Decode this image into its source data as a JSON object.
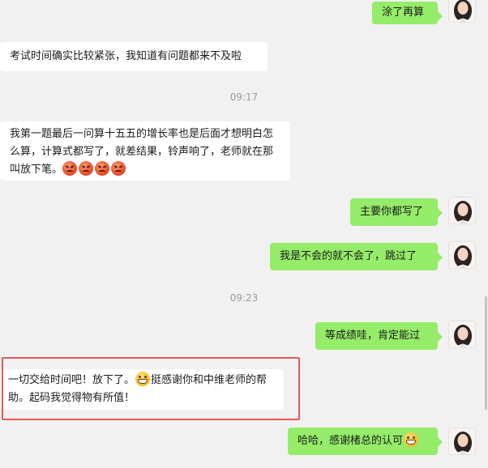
{
  "messages": [
    {
      "id": "m1",
      "type": "out",
      "text": "涂了再算"
    },
    {
      "id": "m2",
      "type": "in",
      "text": "考试时间确实比较紧张，我知道有问题都来不及啦"
    },
    {
      "id": "t1",
      "type": "time",
      "text": "09:17"
    },
    {
      "id": "m3",
      "type": "in",
      "text": "我第一题最后一问算十五五的增长率也是后面才想明白怎么算，计算式都写了，就差结果，铃声响了，老师就在那叫放下笔。",
      "emoji": "angry-face",
      "emoji_count": 4
    },
    {
      "id": "m4",
      "type": "out",
      "text": "主要你都写了"
    },
    {
      "id": "m5",
      "type": "out",
      "text": "我是不会的就不会了，跳过了"
    },
    {
      "id": "t2",
      "type": "time",
      "text": "09:23"
    },
    {
      "id": "m6",
      "type": "out",
      "text": "等成绩哇，肯定能过"
    },
    {
      "id": "m7",
      "type": "in",
      "text_before": "一切交给时间吧！放下了。",
      "text_after": "挺感谢你和中维老师的帮助。起码我觉得物有所值！",
      "emoji": "grin-face",
      "highlighted": true
    },
    {
      "id": "m8",
      "type": "out",
      "text": "哈哈，感谢楮总的认可",
      "emoji": "grin-face"
    }
  ],
  "colors": {
    "background": "#f1f1f1",
    "incoming_bubble": "#ffffff",
    "outgoing_bubble": "#95ec69",
    "highlight_border": "#e45a5a",
    "timestamp": "#9a9a9a"
  }
}
